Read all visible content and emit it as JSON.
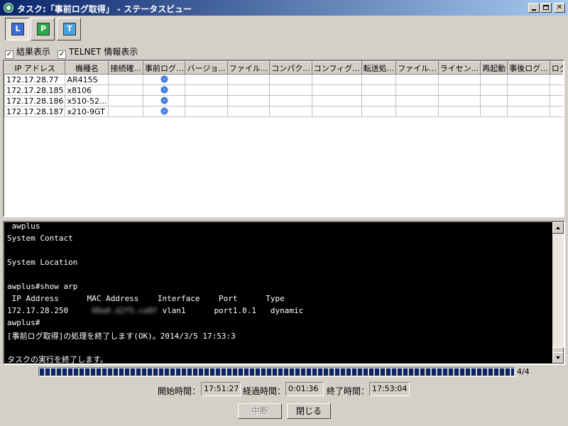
{
  "window": {
    "title": "タスク:「事前ログ取得」 - ステータスビュー"
  },
  "toolbar": {
    "buttons": [
      {
        "glyph": "L",
        "icon": "log-view-icon",
        "pressed": true
      },
      {
        "glyph": "P",
        "icon": "print-icon",
        "pressed": false
      },
      {
        "glyph": "T",
        "icon": "terminal-icon",
        "pressed": false
      }
    ]
  },
  "options": {
    "show_results": {
      "label": "結果表示",
      "checked": true
    },
    "show_telnet": {
      "label": "TELNET 情報表示",
      "checked": true
    }
  },
  "grid": {
    "columns": [
      "IP アドレス",
      "機種名",
      "接続確...",
      "事前ログ...",
      "バージョ...",
      "ファイル...",
      "コンパク...",
      "コンフィグ...",
      "転送処...",
      "ファイル...",
      "ライセン...",
      "再起動",
      "事後ログ...",
      "ログ比較"
    ],
    "rows": [
      {
        "ip": "172.17.28.77",
        "model": "AR415S",
        "status": "busy"
      },
      {
        "ip": "172.17.28.185",
        "model": "x8106",
        "status": "busy"
      },
      {
        "ip": "172.17.28.186",
        "model": "x510-52...",
        "status": "busy"
      },
      {
        "ip": "172.17.28.187",
        "model": "x210-9GT",
        "status": "busy"
      }
    ]
  },
  "console": {
    "lines": [
      " awplus",
      "System Contact",
      "",
      "System Location",
      "",
      "awplus#show arp",
      " IP Address      MAC Address    Interface    Port      Type",
      "172.17.28.250",
      "awplus#",
      "[事前ログ取得]の処理を終了します(OK)。2014/3/5 17:53:3",
      "",
      "タスクの実行を終了します。"
    ],
    "arp_row": {
      "mac": "00a0.d2f5.ca8f",
      "interface": "vlan1",
      "port": "port1.0.1",
      "type": "dynamic"
    }
  },
  "progress": {
    "completed": 4,
    "total": 4,
    "text": "4/4"
  },
  "times": {
    "start_label": "開始時間：",
    "start": "17:51:27",
    "elapsed_label": "経過時間：",
    "elapsed": "0:01:36",
    "end_label": "終了時間：",
    "end": "17:53:04"
  },
  "buttons": {
    "stop": "中断",
    "close": "閉じる"
  }
}
